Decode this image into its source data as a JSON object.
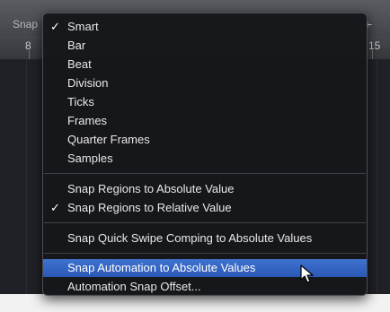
{
  "toolbar": {
    "snap_label": "Snap",
    "snap_icon": "snap-icon"
  },
  "ruler": {
    "left_number": "8",
    "right_number": "15"
  },
  "menu": {
    "items": [
      {
        "label": "Smart",
        "checked": true
      },
      {
        "label": "Bar",
        "checked": false
      },
      {
        "label": "Beat",
        "checked": false
      },
      {
        "label": "Division",
        "checked": false
      },
      {
        "label": "Ticks",
        "checked": false
      },
      {
        "label": "Frames",
        "checked": false
      },
      {
        "label": "Quarter Frames",
        "checked": false
      },
      {
        "label": "Samples",
        "checked": false
      },
      {
        "label": "Snap Regions to Absolute Value",
        "checked": false
      },
      {
        "label": "Snap Regions to Relative Value",
        "checked": true
      },
      {
        "label": "Snap Quick Swipe Comping to Absolute Values",
        "checked": false
      },
      {
        "label": "Snap Automation to Absolute Values",
        "checked": false,
        "highlighted": true
      },
      {
        "label": "Automation Snap Offset...",
        "checked": false
      }
    ],
    "check_glyph": "✓",
    "highlight_color": "#3464c2"
  }
}
